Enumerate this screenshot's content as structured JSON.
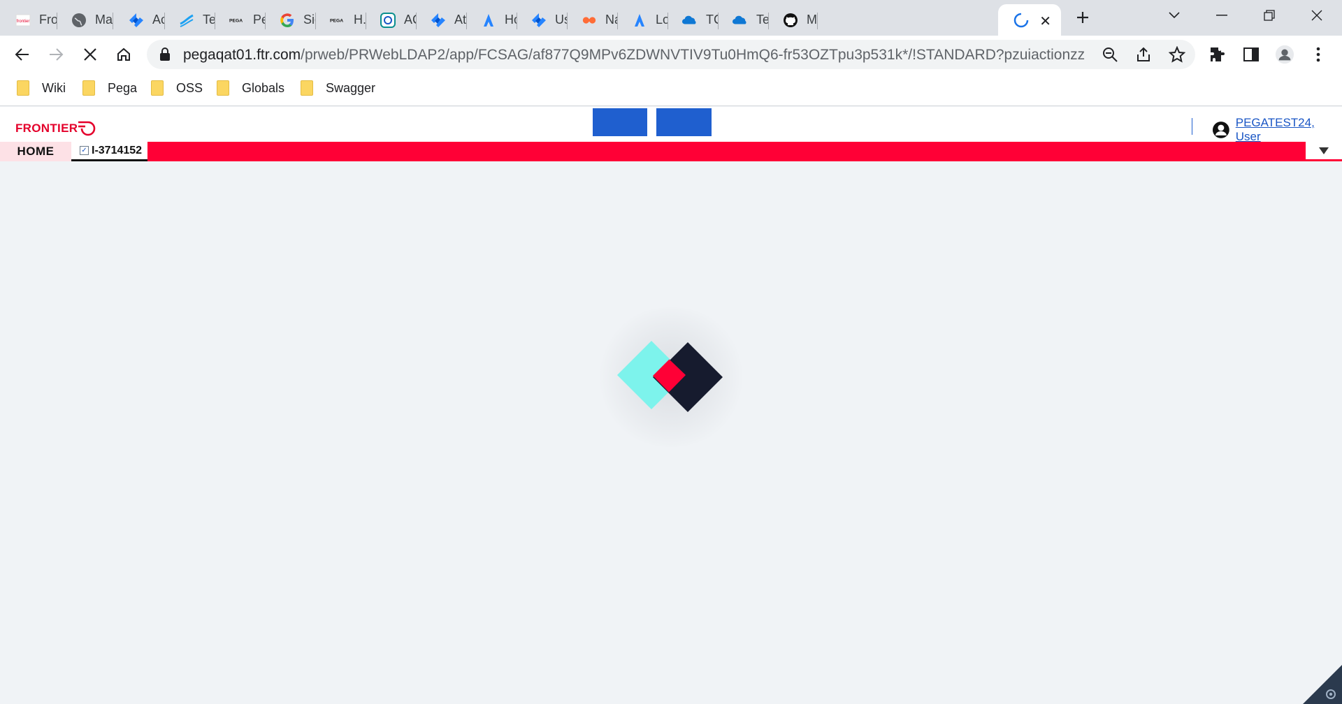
{
  "browser": {
    "tabs": [
      {
        "title": "Frontier",
        "icon": "frontier-favicon"
      },
      {
        "title": "Map",
        "icon": "globe-icon"
      },
      {
        "title": "Acc",
        "icon": "jira-icon"
      },
      {
        "title": "Test",
        "icon": "testrail-icon"
      },
      {
        "title": "Peg",
        "icon": "pega-icon"
      },
      {
        "title": "Sign",
        "icon": "google-icon"
      },
      {
        "title": "H.U",
        "icon": "pega-icon"
      },
      {
        "title": "ACC",
        "icon": "qtest-icon"
      },
      {
        "title": "Atla",
        "icon": "jira-icon"
      },
      {
        "title": "How",
        "icon": "atlassian-icon"
      },
      {
        "title": "Use",
        "icon": "jira-icon"
      },
      {
        "title": "Nar",
        "icon": "postman-icon"
      },
      {
        "title": "Log",
        "icon": "atlassian-icon"
      },
      {
        "title": "TCS",
        "icon": "onedrive-icon"
      },
      {
        "title": "Test",
        "icon": "onedrive-icon"
      },
      {
        "title": "Mal",
        "icon": "github-icon"
      }
    ],
    "active_tab": {
      "title": "",
      "state": "loading"
    },
    "url_host": "pegaqat01.ftr.com",
    "url_path": "/prweb/PRWebLDAP2/app/FCSAG/af877Q9MPv6ZDWNVTIV9Tu0HmQ6-fr53OZTpu3p531k*/!STANDARD?pzuiactionzzz...",
    "bookmarks": [
      "Wiki",
      "Pega",
      "OSS",
      "Globals",
      "Swagger"
    ]
  },
  "app": {
    "logo_text": "FRONTIER",
    "user_link": "PEGATEST24, User",
    "home_tab": "HOME",
    "case_tab": "I-3714152",
    "colors": {
      "brand_red": "#ff0036",
      "header_button_blue": "#1f5fcf",
      "loader_cyan": "#7df3ec",
      "loader_navy": "#161b2e"
    }
  }
}
